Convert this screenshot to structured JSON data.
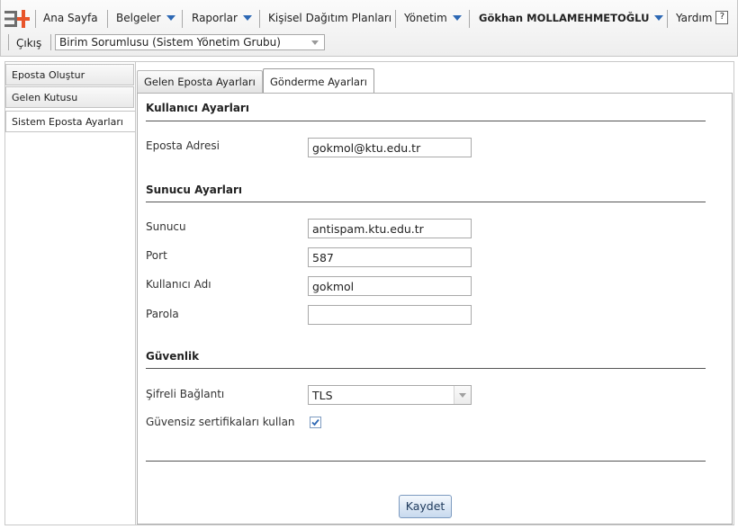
{
  "topbar": {
    "logo": "ebys-logo",
    "home_label": "Ana Sayfa",
    "documents_label": "Belgeler",
    "reports_label": "Raporlar",
    "distribution_label": "Kişisel Dağıtım Planları",
    "admin_label": "Yönetim",
    "user_label": "Gökhan MOLLAMEHMETOĞLU",
    "help_label": "Yardım",
    "help_icon": "?",
    "logout_label": "Çıkış",
    "role_value": "Birim Sorumlusu (Sistem Yönetim Grubu)",
    "accent_color": "#2d68b4"
  },
  "sidebar": {
    "items": [
      {
        "label": "Eposta Oluştur"
      },
      {
        "label": "Gelen Kutusu"
      },
      {
        "label": "Sistem Eposta Ayarları"
      }
    ],
    "active_index": 2
  },
  "tabs": [
    {
      "label": "Gelen Eposta Ayarları"
    },
    {
      "label": "Gönderme Ayarları"
    }
  ],
  "active_tab": 1,
  "form": {
    "user_section": "Kullanıcı Ayarları",
    "email_label": "Eposta Adresi",
    "email_value": "gokmol@ktu.edu.tr",
    "server_section": "Sunucu Ayarları",
    "server_label": "Sunucu",
    "server_value": "antispam.ktu.edu.tr",
    "port_label": "Port",
    "port_value": "587",
    "username_label": "Kullanıcı Adı",
    "username_value": "gokmol",
    "password_label": "Parola",
    "password_value": "",
    "security_section": "Güvenlik",
    "encrypted_label": "Şifreli Bağlantı",
    "encrypted_value": "TLS",
    "insecure_cert_label": "Güvensiz sertifikaları kullan",
    "insecure_cert_checked": true,
    "save_label": "Kaydet"
  }
}
